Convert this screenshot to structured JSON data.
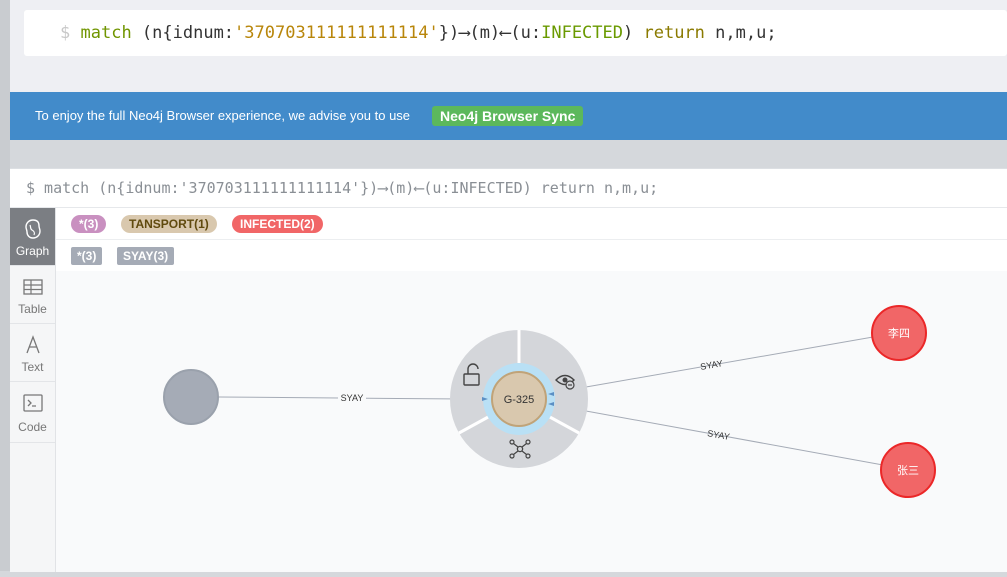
{
  "editor": {
    "prompt": "$",
    "query_parts": {
      "kw": "match",
      "p1": " (n{idnum:",
      "str": "'370703111111111114'",
      "p2": "})⟶(m)⟵(u:",
      "label": "INFECTED",
      "p3": ") ",
      "ret": "return",
      "p4": " n,m,u;"
    }
  },
  "banner": {
    "text": "To enjoy the full Neo4j Browser experience, we advise you to use",
    "button": "Neo4j Browser Sync"
  },
  "frame": {
    "title": "$ match (n{idnum:'370703111111111114'})⟶(m)⟵(u:INFECTED) return n,m,u;"
  },
  "sidebar": {
    "items": [
      {
        "label": "Graph",
        "icon": "graph-icon",
        "active": true
      },
      {
        "label": "Table",
        "icon": "table-icon",
        "active": false
      },
      {
        "label": "Text",
        "icon": "text-icon",
        "active": false
      },
      {
        "label": "Code",
        "icon": "code-icon",
        "active": false
      }
    ]
  },
  "legend": {
    "node_labels": [
      {
        "text": "*(3)",
        "bg": "#c990c0",
        "fg": "#ffffff"
      },
      {
        "text": "TANSPORT(1)",
        "bg": "#d9c8ae",
        "fg": "#604a0e"
      },
      {
        "text": "INFECTED(2)",
        "bg": "#f16667",
        "fg": "#ffffff"
      }
    ],
    "rel_types": [
      {
        "text": "*(3)"
      },
      {
        "text": "SYAY(3)"
      }
    ]
  },
  "graph": {
    "center_node": "G-325",
    "node_a": "李四",
    "node_b": "张三",
    "edges": [
      "SYAY",
      "SYAY",
      "SYAY"
    ],
    "colors": {
      "infected": "#f16667",
      "infected_border": "#eb2728",
      "transport": "#d9c8ae",
      "default_node": "#a5abb6"
    }
  }
}
